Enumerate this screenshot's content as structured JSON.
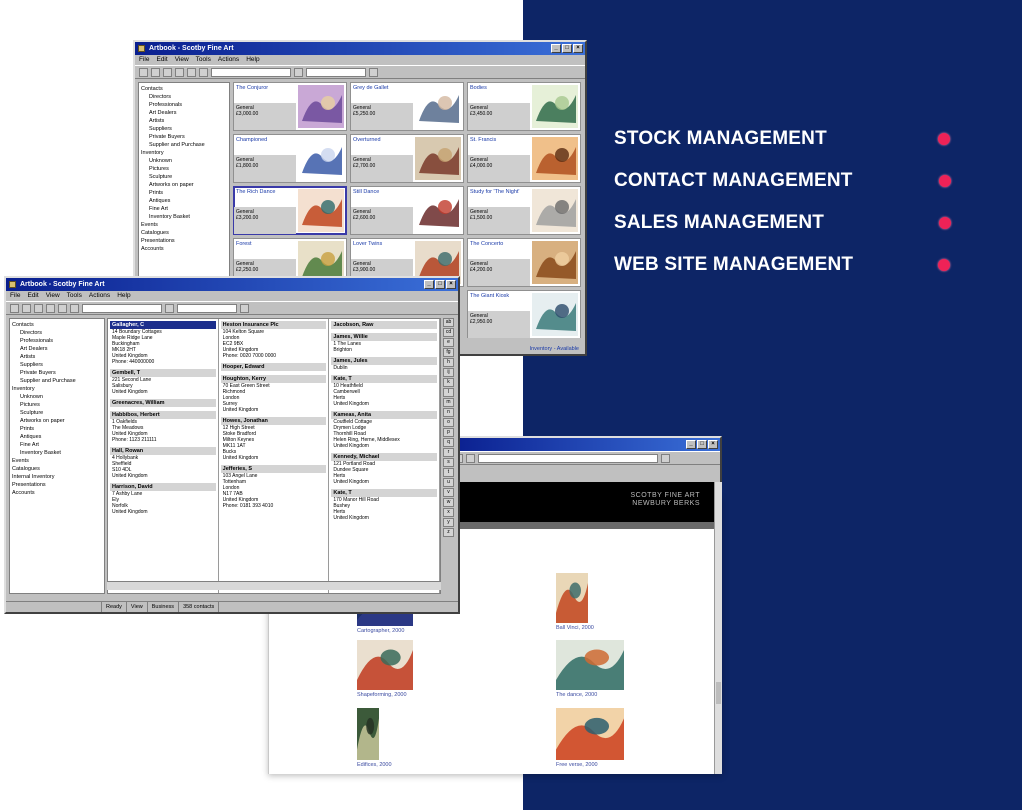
{
  "features": [
    {
      "label": "STOCK MANAGEMENT"
    },
    {
      "label": "CONTACT MANAGEMENT"
    },
    {
      "label": "SALES  MANAGEMENT"
    },
    {
      "label": "WEB SITE  MANAGEMENT"
    }
  ],
  "colors": {
    "navy_panel": "#0d2566",
    "bullet_pink": "#ee2257",
    "title_bar": "#0a1f8f"
  },
  "stock_window": {
    "title": "Artbook - Scotby Fine Art",
    "menu": [
      "File",
      "Edit",
      "View",
      "Tools",
      "Actions",
      "Help"
    ],
    "tree": [
      "Contacts",
      "Directors",
      "Professionals",
      "Art Dealers",
      "Artists",
      "Suppliers",
      "Private Buyers",
      "Supplier and Purchase",
      "Inventory",
      "Unknown",
      "Pictures",
      "Sculpture",
      "Artworks on paper",
      "Prints",
      "Antiques",
      "Fine Art",
      "Inventory Basket",
      "Events",
      "Catalogues",
      "Presentations",
      "Accounts"
    ],
    "tiles": [
      {
        "name": "The Conjuror",
        "meta": "General",
        "price": "£3,000.00",
        "selected": false
      },
      {
        "name": "Grey de Gallet",
        "meta": "General",
        "price": "£5,250.00",
        "selected": false
      },
      {
        "name": "Bodies",
        "meta": "General",
        "price": "£3,450.00",
        "selected": false
      },
      {
        "name": "Championed",
        "meta": "General",
        "price": "£1,800.00",
        "selected": false
      },
      {
        "name": "Overturned",
        "meta": "General",
        "price": "£2,700.00",
        "selected": false
      },
      {
        "name": "St. Francis",
        "meta": "General",
        "price": "£4,000.00",
        "selected": false
      },
      {
        "name": "The Rich Dance",
        "meta": "General",
        "price": "£3,200.00",
        "selected": true
      },
      {
        "name": "Still Dance",
        "meta": "General",
        "price": "£2,600.00",
        "selected": false
      },
      {
        "name": "Study for 'The Night'",
        "meta": "General",
        "price": "£1,500.00",
        "selected": false
      },
      {
        "name": "Forest",
        "meta": "General",
        "price": "£2,250.00",
        "selected": false
      },
      {
        "name": "Lover Twins",
        "meta": "General",
        "price": "£3,900.00",
        "selected": false
      },
      {
        "name": "The Concerto",
        "meta": "General",
        "price": "£4,200.00",
        "selected": false
      },
      {
        "name": "",
        "meta": "",
        "price": "",
        "selected": false
      },
      {
        "name": "",
        "meta": "",
        "price": "",
        "selected": false
      },
      {
        "name": "The Giant Kiosk",
        "meta": "General",
        "price": "£2,950.00",
        "selected": false
      }
    ],
    "status": "Inventory - Available"
  },
  "contacts_window": {
    "title": "Artbook - Scotby Fine Art",
    "menu": [
      "File",
      "Edit",
      "View",
      "Tools",
      "Actions",
      "Help"
    ],
    "tree": [
      "Contacts",
      "Directors",
      "Professionals",
      "Art Dealers",
      "Artists",
      "Suppliers",
      "Private Buyers",
      "Supplier and Purchase",
      "Inventory",
      "Unknown",
      "Pictures",
      "Sculpture",
      "Artworks on paper",
      "Prints",
      "Antiques",
      "Fine Art",
      "Inventory Basket",
      "Events",
      "Catalogues",
      "Internal Inventory",
      "Presentations",
      "Accounts"
    ],
    "columns": [
      [
        {
          "name": "Gallagher, C",
          "selected": true,
          "lines": [
            "14 Boundary Cottages",
            "Maple Ridge Lane",
            "Buckingham",
            "MK18 2HT",
            "United Kingdom",
            "Phone: 440000000"
          ]
        },
        {
          "name": "Gembell, T",
          "selected": false,
          "lines": [
            "221 Second Lane",
            "Salisbury",
            "United Kingdom"
          ]
        },
        {
          "name": "Greenacres, William",
          "selected": false,
          "lines": []
        },
        {
          "name": "Habbibos, Herbert",
          "selected": false,
          "lines": [
            "1 Oakfields",
            "The Meadows",
            "United Kingdom",
            "Phone: 1123 211111"
          ]
        },
        {
          "name": "Hall, Rowan",
          "selected": false,
          "lines": [
            "4 Hollybank",
            "Sheffield",
            "S10 4DL",
            "United Kingdom"
          ]
        },
        {
          "name": "Harrison, David",
          "selected": false,
          "lines": [
            "7 Ashby Lane",
            "Ely",
            "Norfolk",
            "United Kingdom"
          ]
        }
      ],
      [
        {
          "name": "Heston Insurance Plc",
          "selected": false,
          "lines": [
            "104 Kelton Square",
            "London",
            "EC2 9BX",
            "United Kingdom",
            "Phone: 0020 7000 0000"
          ]
        },
        {
          "name": "Hooper, Edward",
          "selected": false,
          "lines": []
        },
        {
          "name": "Houghton, Kerry",
          "selected": false,
          "lines": [
            "70 East Green Street",
            "Richmond",
            "London",
            "Surrey",
            "United Kingdom"
          ]
        },
        {
          "name": "Howes, Jonathan",
          "selected": false,
          "lines": [
            "12 High Street",
            "Stoke Bradford",
            "Milton Keynes",
            "MK11 1AT",
            "Bucks",
            "United Kingdom"
          ]
        },
        {
          "name": "Jefferies, S",
          "selected": false,
          "lines": [
            "103 Angel Lane",
            "Tottenham",
            "London",
            "N17 7AB",
            "United Kingdom",
            "Phone: 0181 393 4010"
          ]
        }
      ],
      [
        {
          "name": "Jacobson, Raw",
          "selected": false,
          "lines": []
        },
        {
          "name": "James, Willie",
          "selected": false,
          "lines": [
            "1 The Lanes",
            "Brighton"
          ]
        },
        {
          "name": "James, Jules",
          "selected": false,
          "lines": [
            "Dublin"
          ]
        },
        {
          "name": "Kate, T",
          "selected": false,
          "lines": [
            "10 Heathfield",
            "Camberwell",
            "Herts",
            "United Kingdom"
          ]
        },
        {
          "name": "Kameas, Anita",
          "selected": false,
          "lines": [
            "Coutfield Cottage",
            "Drymen Lodge",
            "Thornhill Road",
            "Helen Ring, Herne, Middlesex",
            "United Kingdom"
          ]
        },
        {
          "name": "Kennedy, Michael",
          "selected": false,
          "lines": [
            "121 Portland Road",
            "Dundee Square",
            "Herts",
            "United Kingdom"
          ]
        },
        {
          "name": "Kate, T",
          "selected": false,
          "lines": [
            "170 Manor Hill Road",
            "Bushey",
            "Herts",
            "United Kingdom"
          ]
        }
      ]
    ],
    "letters": [
      "ab",
      "cd",
      "e",
      "fg",
      "h",
      "ij",
      "k",
      "l",
      "m",
      "n",
      "o",
      "p",
      "q",
      "r",
      "s",
      "t",
      "u",
      "v",
      "w",
      "x",
      "y",
      "z"
    ],
    "status": [
      "Ready",
      "View",
      "Business",
      "358 contacts"
    ]
  },
  "browser": {
    "logo_line1": "SCOTBY FINE ART",
    "logo_line2": "NEWBURY  BERKS",
    "artworks": [
      {
        "caption": "Ball Vinci, 2000",
        "palette": [
          "#e9d7b7",
          "#c2451f",
          "#3e6d6b"
        ]
      },
      {
        "caption": "Cartographer, 2000",
        "palette": [
          "#1b2e6a",
          "#2e3a8a",
          "#8a97c3"
        ]
      },
      {
        "caption": "Shapeforming, 2000",
        "palette": [
          "#eadfcf",
          "#c0391e",
          "#3a6b5a"
        ]
      },
      {
        "caption": "The dance, 2000",
        "palette": [
          "#dfe6dc",
          "#2f6b64",
          "#cf6a33"
        ]
      },
      {
        "caption": "Edifices, 2000",
        "palette": [
          "#3c5a3a",
          "#c7c79a",
          "#263325"
        ]
      },
      {
        "caption": "Free verse, 2000",
        "palette": [
          "#f2d3a8",
          "#cc3f1e",
          "#2b5e6e"
        ]
      }
    ]
  }
}
